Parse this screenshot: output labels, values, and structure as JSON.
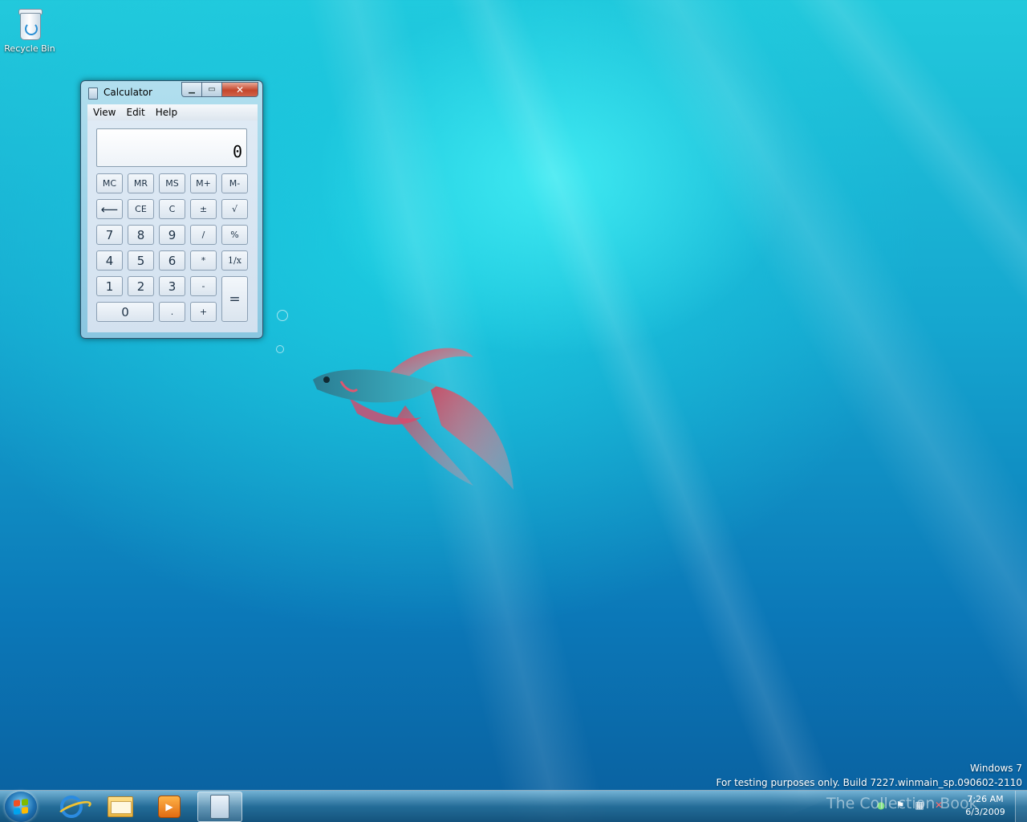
{
  "desktop": {
    "icons": [
      {
        "label": "Recycle Bin",
        "icon": "recycle-bin-icon"
      }
    ],
    "watermark": {
      "line1": "Windows 7",
      "line2": "For testing purposes only. Build 7227.winmain_sp.090602-2110"
    },
    "brand_overlay": "The Collection Book"
  },
  "calculator": {
    "title": "Calculator",
    "menu": [
      "View",
      "Edit",
      "Help"
    ],
    "display": "0",
    "keys": {
      "mc": "MC",
      "mr": "MR",
      "ms": "MS",
      "mplus": "M+",
      "mminus": "M-",
      "back": "⟵",
      "ce": "CE",
      "c": "C",
      "plusminus": "±",
      "sqrt": "√",
      "k7": "7",
      "k8": "8",
      "k9": "9",
      "div": "/",
      "pct": "%",
      "k4": "4",
      "k5": "5",
      "k6": "6",
      "mul": "*",
      "recip": "1/x",
      "k1": "1",
      "k2": "2",
      "k3": "3",
      "sub": "-",
      "eq": "=",
      "k0": "0",
      "dot": ".",
      "add": "+"
    }
  },
  "taskbar": {
    "pinned": [
      "internet-explorer-icon",
      "windows-explorer-icon",
      "media-player-icon",
      "calculator-icon"
    ],
    "clock": {
      "time": "7:26 AM",
      "date": "6/3/2009"
    },
    "colors": {
      "accent": "#2b8be0",
      "close_button": "#c4472c"
    }
  }
}
